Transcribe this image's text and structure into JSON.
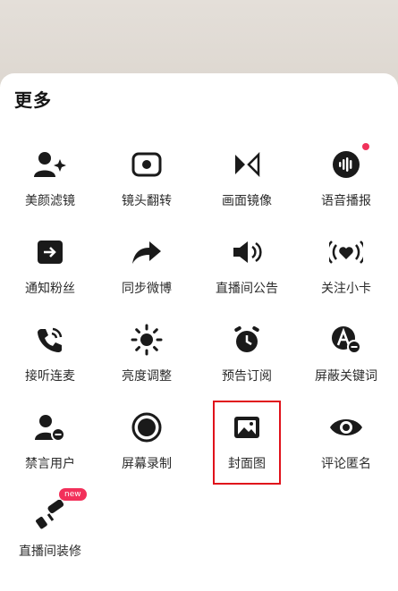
{
  "sheet": {
    "title": "更多"
  },
  "items": [
    {
      "label": "美颜滤镜",
      "icon": "user-sparkle-icon"
    },
    {
      "label": "镜头翻转",
      "icon": "camera-flip-icon"
    },
    {
      "label": "画面镜像",
      "icon": "mirror-icon"
    },
    {
      "label": "语音播报",
      "icon": "voice-wave-icon",
      "dot": true
    },
    {
      "label": "通知粉丝",
      "icon": "notify-arrow-icon"
    },
    {
      "label": "同步微博",
      "icon": "share-arrow-icon"
    },
    {
      "label": "直播间公告",
      "icon": "speaker-icon"
    },
    {
      "label": "关注小卡",
      "icon": "heart-broadcast-icon"
    },
    {
      "label": "接听连麦",
      "icon": "phone-icon"
    },
    {
      "label": "亮度调整",
      "icon": "sun-icon"
    },
    {
      "label": "预告订阅",
      "icon": "alarm-clock-icon"
    },
    {
      "label": "屏蔽关键词",
      "icon": "text-block-icon"
    },
    {
      "label": "禁言用户",
      "icon": "user-mute-icon"
    },
    {
      "label": "屏幕录制",
      "icon": "record-icon"
    },
    {
      "label": "封面图",
      "icon": "image-icon",
      "highlighted": true
    },
    {
      "label": "评论匿名",
      "icon": "eye-icon"
    },
    {
      "label": "直播间装修",
      "icon": "paint-roller-icon",
      "badge": "new"
    }
  ],
  "colors": {
    "icon": "#1a1a1a",
    "accent": "#f0325a",
    "highlight": "#e0121b"
  }
}
